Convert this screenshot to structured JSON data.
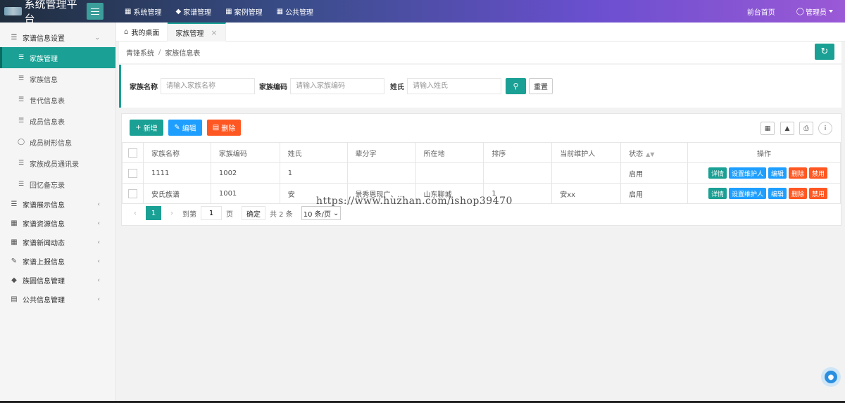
{
  "header": {
    "app_title": "系统管理平台",
    "nav": [
      {
        "icon": "grid-icon",
        "label": "系统管理"
      },
      {
        "icon": "layers-icon",
        "label": "家谱管理"
      },
      {
        "icon": "grid-icon",
        "label": "案例管理"
      },
      {
        "icon": "grid-icon",
        "label": "公共管理"
      }
    ],
    "front_link": "前台首页",
    "user": "管理员"
  },
  "sidebar": {
    "group_settings": "家谱信息设置",
    "items": [
      {
        "label": "家族管理"
      },
      {
        "label": "家族信息"
      },
      {
        "label": "世代信息表"
      },
      {
        "label": "成员信息表"
      },
      {
        "label": "成员树形信息"
      },
      {
        "label": "家族成员通讯录"
      },
      {
        "label": "回忆备忘录"
      }
    ],
    "groups": [
      {
        "label": "家谱展示信息"
      },
      {
        "label": "家谱资源信息"
      },
      {
        "label": "家谱新闻动态"
      },
      {
        "label": "家谱上报信息"
      },
      {
        "label": "族圆信息管理"
      },
      {
        "label": "公共信息管理"
      }
    ]
  },
  "tabs": [
    {
      "label": "我的桌面"
    },
    {
      "label": "家族管理"
    }
  ],
  "breadcrumb": {
    "root": "青锋系统",
    "sep": "/",
    "current": "家族信息表"
  },
  "search": {
    "family_name_label": "家族名称",
    "family_name_placeholder": "请输入家族名称",
    "family_code_label": "家族编码",
    "family_code_placeholder": "请输入家族编码",
    "surname_label": "姓氏",
    "surname_placeholder": "请输入姓氏",
    "reset_label": "重置"
  },
  "toolbar": {
    "add_label": "新增",
    "edit_label": "编辑",
    "delete_label": "删除"
  },
  "table": {
    "columns": [
      "家族名称",
      "家族编码",
      "姓氏",
      "辈分字",
      "所在地",
      "排序",
      "当前维护人",
      "状态",
      "操作"
    ],
    "rows": [
      {
        "name": "1111",
        "code": "1002",
        "surname": "1",
        "generation": "",
        "location": "",
        "order": "",
        "maintainer": "",
        "status": "启用"
      },
      {
        "name": "安氏族谱",
        "code": "1001",
        "surname": "安",
        "generation": "景秀恩现广、...",
        "location": "山东聊城",
        "order": "1",
        "maintainer": "安xx",
        "status": "启用"
      }
    ],
    "ops": [
      "详情",
      "设置维护人",
      "编辑",
      "删除",
      "禁用"
    ]
  },
  "pager": {
    "current_page": "1",
    "goto_label": "到第",
    "page_input": "1",
    "page_unit": "页",
    "confirm_label": "确定",
    "total": "共 2 条",
    "page_size": "10 条/页"
  },
  "watermark": "https://www.huzhan.com/ishop39470",
  "colors": {
    "primary": "#1aa094",
    "blue": "#1e9fff",
    "danger": "#ff5722",
    "success_text": "#1ec34b"
  }
}
